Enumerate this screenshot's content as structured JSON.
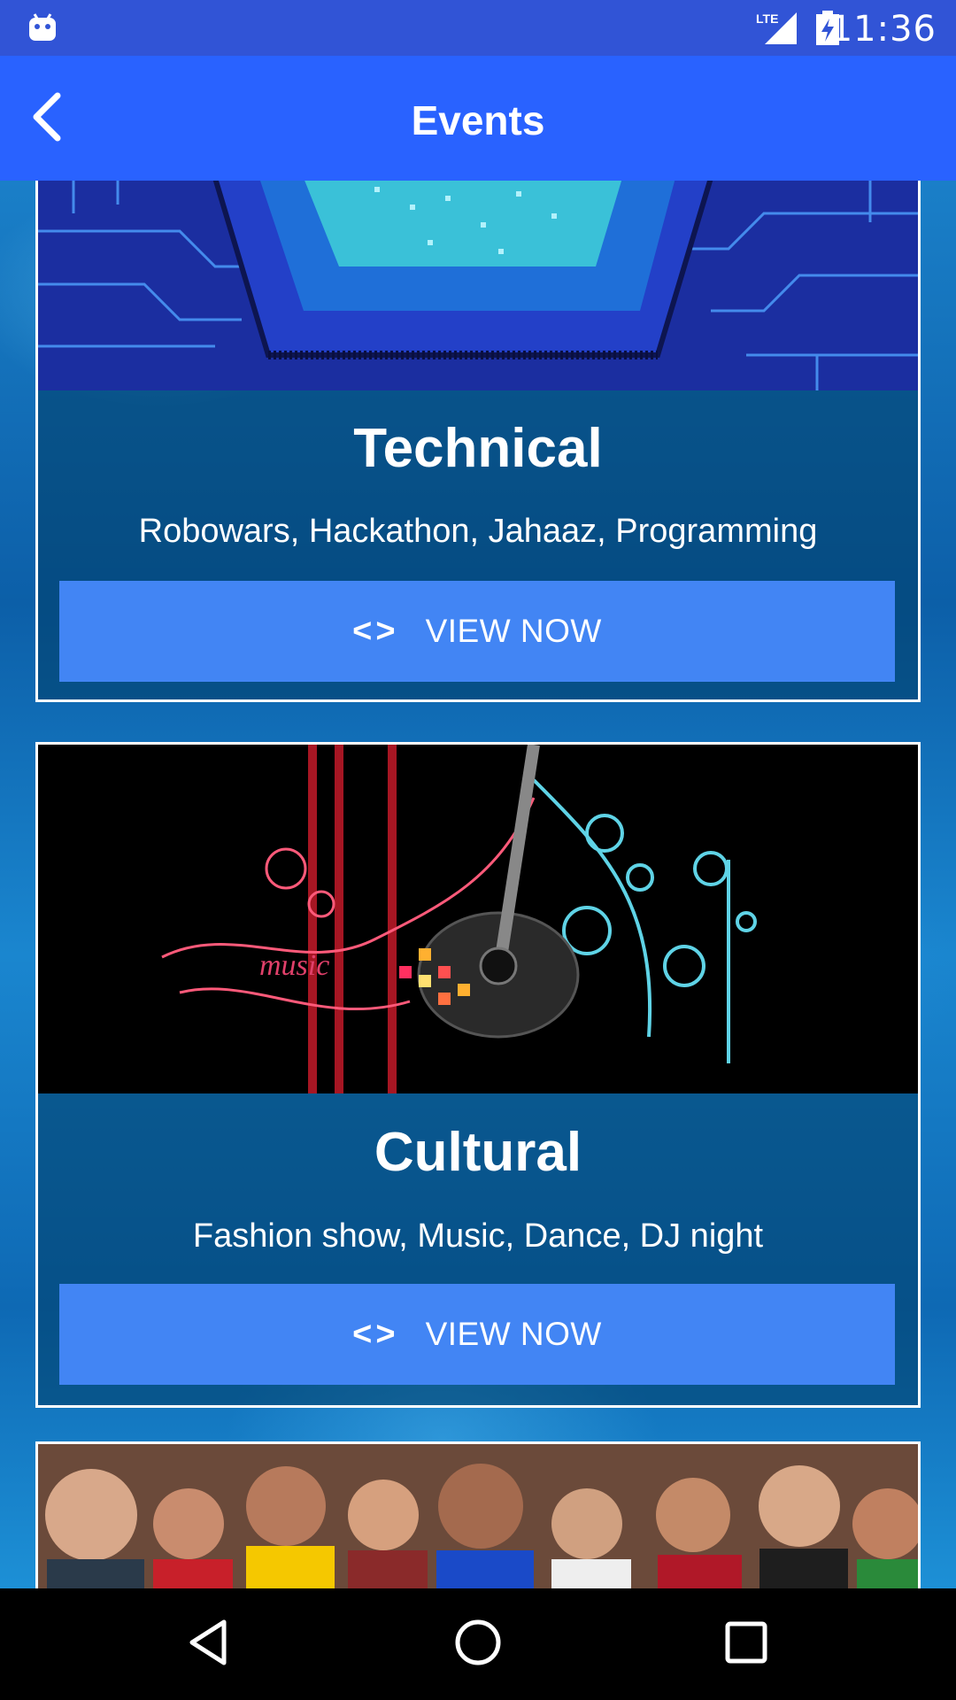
{
  "status_bar": {
    "time": "11:36",
    "network_label": "LTE",
    "icons": [
      "android-icon",
      "lte-signal-icon",
      "battery-charging-icon"
    ]
  },
  "app_bar": {
    "title": "Events",
    "back_icon": "chevron-left-icon"
  },
  "events": [
    {
      "title": "Technical",
      "description": "Robowars, Hackathon, Jahaaz, Programming",
      "button_label": "VIEW NOW",
      "button_icon": "code-icon"
    },
    {
      "title": "Cultural",
      "description": "Fashion show, Music, Dance, DJ night",
      "button_label": "VIEW NOW",
      "button_icon": "code-icon"
    },
    {
      "title": "",
      "description": "",
      "button_label": "",
      "button_icon": ""
    }
  ],
  "nav_bar": {
    "icons": [
      "back-triangle-icon",
      "home-circle-icon",
      "recents-square-icon"
    ]
  },
  "colors": {
    "status_bar": "#3154d6",
    "app_bar": "#2962ff",
    "button": "#4285f4",
    "card_border": "#ffffff"
  }
}
